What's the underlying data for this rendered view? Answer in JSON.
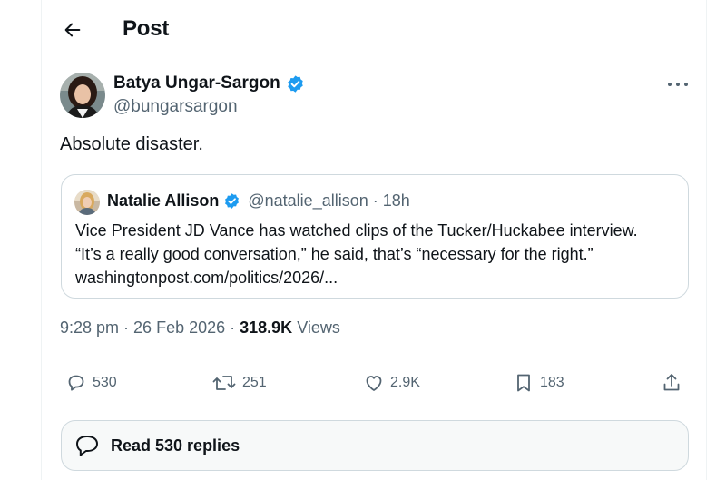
{
  "header": {
    "title": "Post"
  },
  "author": {
    "name": "Batya Ungar-Sargon",
    "handle": "@bungarsargon",
    "verified": true
  },
  "tweet": {
    "text": "Absolute disaster."
  },
  "quote": {
    "name": "Natalie Allison",
    "handle": "@natalie_allison",
    "separator": "·",
    "time": "18h",
    "lines": [
      "Vice President JD Vance has watched clips of the Tucker/Huckabee interview.",
      "“It’s a really good conversation,” he said, that’s “necessary for the right.”",
      "washingtonpost.com/politics/2026/..."
    ]
  },
  "meta": {
    "time": "9:28 pm",
    "sep1": "·",
    "date": "26 Feb 2026",
    "sep2": "·",
    "views_count": "318.9K",
    "views_label": "Views"
  },
  "actions": {
    "replies": "530",
    "reposts": "251",
    "likes": "2.9K",
    "bookmarks": "183"
  },
  "read_replies": {
    "label": "Read 530 replies"
  },
  "colors": {
    "verified": "#1d9bf0",
    "secondary_text": "#536471",
    "border": "#cfd9de"
  }
}
